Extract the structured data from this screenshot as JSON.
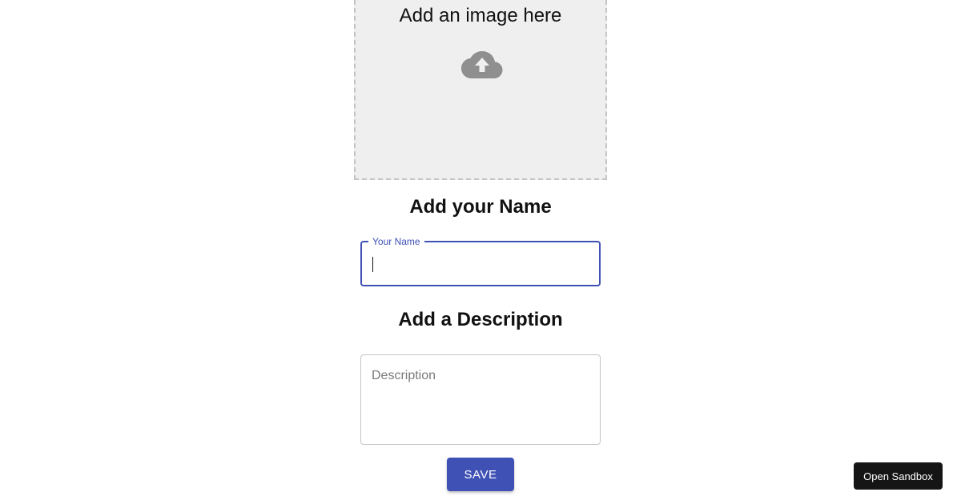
{
  "dropzone": {
    "title": "Add an image here",
    "icon": "cloud-upload-icon",
    "icon_color": "#8f8f8f"
  },
  "name_section": {
    "heading": "Add your Name",
    "field_label": "Your Name",
    "value": ""
  },
  "description_section": {
    "heading": "Add a Description",
    "placeholder": "Description",
    "value": ""
  },
  "save_button": {
    "label": "SAVE"
  },
  "sandbox_button": {
    "label": "Open Sandbox"
  },
  "colors": {
    "accent": "#3f51b5",
    "dropzone_bg": "#efefef",
    "sandbox_bg": "#151515"
  }
}
